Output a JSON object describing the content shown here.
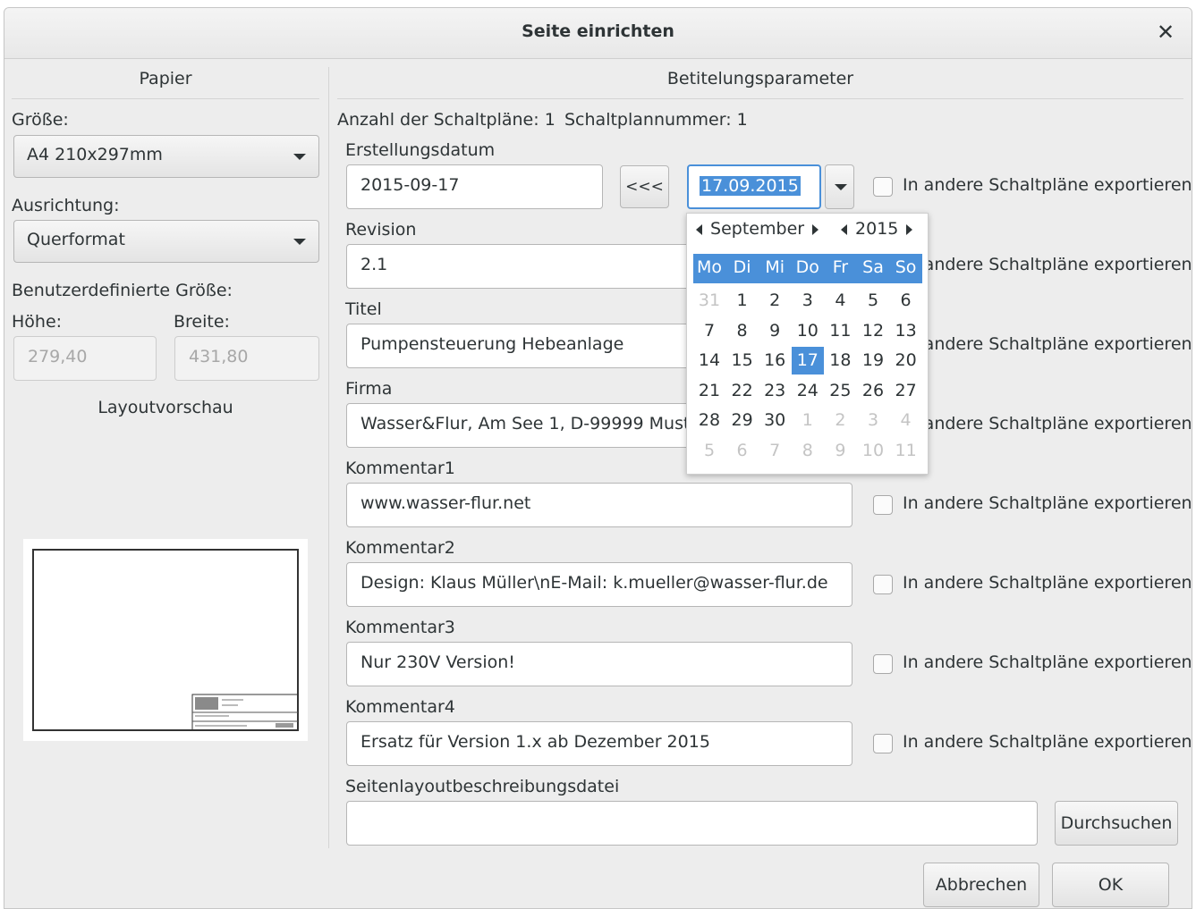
{
  "window": {
    "title": "Seite einrichten"
  },
  "paper": {
    "header": "Papier",
    "size_label": "Größe:",
    "size_value": "A4 210x297mm",
    "orientation_label": "Ausrichtung:",
    "orientation_value": "Querformat",
    "custom_size_label": "Benutzerdefinierte Größe:",
    "height_label": "Höhe:",
    "width_label": "Breite:",
    "height_value": "279,40",
    "width_value": "431,80",
    "preview_label": "Layoutvorschau"
  },
  "title_block": {
    "header": "Betitelungsparameter",
    "sheet_count": "Anzahl der Schaltpläne: 1",
    "sheet_number": "Schaltplannummer: 1",
    "export_label": "In andere Schaltpläne exportieren",
    "date_label": "Erstellungsdatum",
    "date_value": "2015-09-17",
    "copy_button": "<<<",
    "date_picker_value": "17.09.2015",
    "revision_label": "Revision",
    "revision_value": "2.1",
    "title_label": "Titel",
    "title_value": "Pumpensteuerung Hebeanlage",
    "company_label": "Firma",
    "company_value": "Wasser&Flur, Am See 1, D-99999 Musterstadt",
    "comment1_label": "Kommentar1",
    "comment1_value": "www.wasser-flur.net",
    "comment2_label": "Kommentar2",
    "comment2_value": "Design: Klaus Müller\\nE-Mail: k.mueller@wasser-flur.de",
    "comment3_label": "Kommentar3",
    "comment3_value": "Nur 230V Version!",
    "comment4_label": "Kommentar4",
    "comment4_value": "Ersatz für Version 1.x ab Dezember 2015",
    "layout_file_label": "Seitenlayoutbeschreibungsdatei",
    "layout_file_value": "",
    "browse_button": "Durchsuchen"
  },
  "calendar": {
    "month": "September",
    "year": "2015",
    "weekdays": [
      "Mo",
      "Di",
      "Mi",
      "Do",
      "Fr",
      "Sa",
      "So"
    ],
    "weeks": [
      [
        "31",
        "1",
        "2",
        "3",
        "4",
        "5",
        "6"
      ],
      [
        "7",
        "8",
        "9",
        "10",
        "11",
        "12",
        "13"
      ],
      [
        "14",
        "15",
        "16",
        "17",
        "18",
        "19",
        "20"
      ],
      [
        "21",
        "22",
        "23",
        "24",
        "25",
        "26",
        "27"
      ],
      [
        "28",
        "29",
        "30",
        "1",
        "2",
        "3",
        "4"
      ],
      [
        "5",
        "6",
        "7",
        "8",
        "9",
        "10",
        "11"
      ]
    ],
    "selected_day": "17"
  },
  "footer": {
    "cancel_button": "Abbrechen",
    "ok_button": "OK"
  },
  "colors": {
    "accent": "#4a90d9",
    "dialog_bg": "#ededed"
  },
  "icons": {
    "close": "close-icon",
    "dropdown": "chevron-down-icon"
  }
}
